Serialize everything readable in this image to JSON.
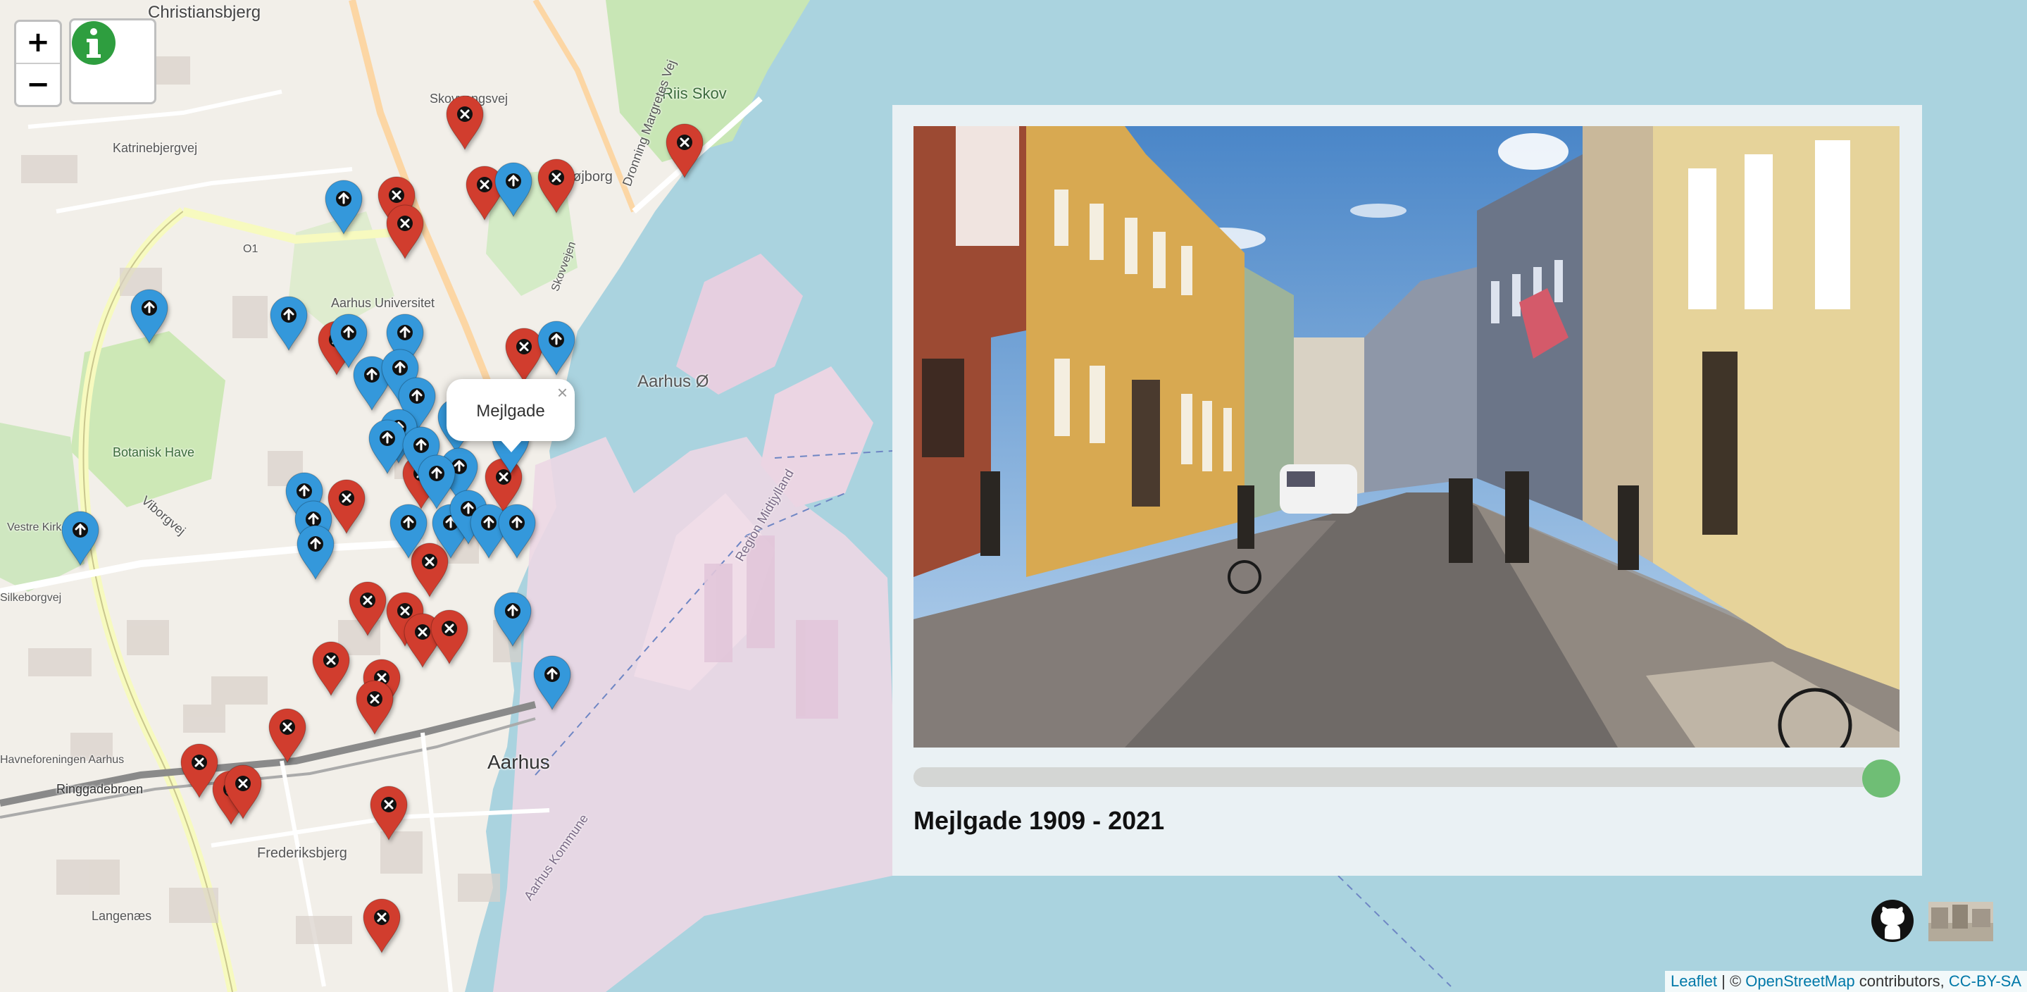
{
  "map": {
    "labels": [
      "Christiansbjerg",
      "Skovvangsvej",
      "Katrinebjergvej",
      "Riis Skov",
      "Trøjborg",
      "Dronning Margretes Vej",
      "Aarhus Universitet",
      "Aarhus Ø",
      "Botanisk Have",
      "Vestre Kirkegård",
      "Viborgvej",
      "Silkeborgvej",
      "Ringgadebroen",
      "Aarhus",
      "Frederiksbjerg",
      "Langenæs",
      "Region Midtjylland",
      "Aarhus Kommune",
      "Havneforeningen Aarhus",
      "Skovvejen",
      "O1"
    ],
    "water_color": "#aad3df",
    "red_marker_color": "#d13d2e",
    "blue_marker_color": "#3498db",
    "red_marker_icon": "x-icon",
    "blue_marker_icon": "arrow-icon"
  },
  "controls": {
    "zoom_in": "+",
    "zoom_out": "−",
    "info_icon": "info-icon"
  },
  "popup": {
    "title": "Mejlgade",
    "close": "×"
  },
  "panel": {
    "caption": "Mejlgade 1909 - 2021",
    "slider_value": 1.0,
    "slider_color": "#6fbe75"
  },
  "footer": {
    "github_icon": "github-icon",
    "attribution_leaflet": "Leaflet",
    "attribution_sep": " | © ",
    "attribution_osm": "OpenStreetMap",
    "attribution_contrib": " contributors, ",
    "attribution_license": "CC-BY-SA"
  }
}
